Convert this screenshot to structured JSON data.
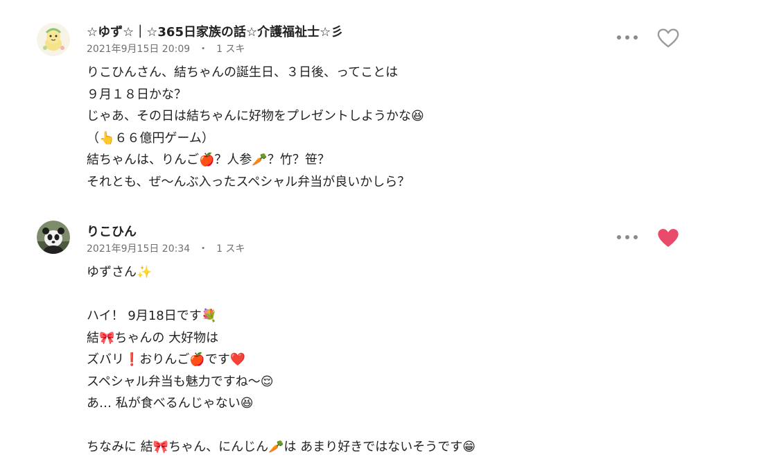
{
  "comments": [
    {
      "author": "☆ゆず☆｜☆365日家族の話☆介護福祉士☆彡",
      "date": "2021年9月15日 20:09",
      "separator": "・",
      "likes": "1 スキ",
      "liked": false,
      "avatar": "yellow-character-avatar",
      "lines": [
        "りこひんさん、結ちゃんの誕生日、３日後、ってことは",
        "９月１８日かな？",
        "じゃあ、その日は結ちゃんに好物をプレゼントしようかな😆",
        "（👆６６億円ゲーム）",
        "結ちゃんは、りんご🍎？人参🥕？竹？笹？",
        "それとも、ぜ〜んぶ入ったスペシャル弁当が良いかしら？"
      ]
    },
    {
      "author": "りこひん",
      "date": "2021年9月15日 20:34",
      "separator": "・",
      "likes": "1 スキ",
      "liked": true,
      "avatar": "panda-avatar",
      "lines": [
        "ゆずさん✨",
        "",
        "ハイ！ 9月18日です💐",
        "結🎀ちゃんの 大好物は",
        "ズバリ❗おりんご🍎です❤️",
        "スペシャル弁当も魅力ですね〜😌",
        "あ… 私が食べるんじゃない😆",
        "",
        "ちなみに 結🎀ちゃん、にんじん🥕は あまり好きではないそうです😁"
      ]
    }
  ],
  "colors": {
    "heart_liked": "#e94a6a",
    "heart_outline": "#9a9a9a",
    "meta_text": "#6f6f6f"
  },
  "icons": {
    "more": "more-dots-icon",
    "heart_outline": "heart-outline-icon",
    "heart_filled": "heart-filled-icon"
  }
}
